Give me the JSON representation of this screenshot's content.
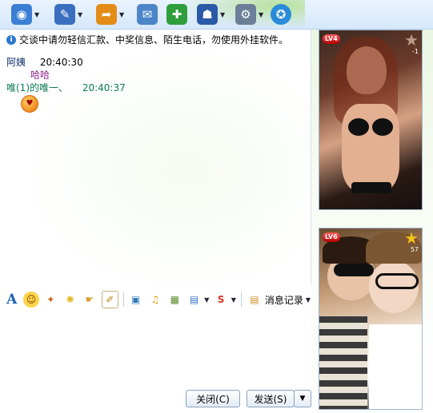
{
  "toolbar": {
    "icons": [
      {
        "name": "video-call-icon",
        "glyph": "◉",
        "color": "#3b7fd4"
      },
      {
        "name": "voice-call-icon",
        "glyph": "✎",
        "color": "#3a6fc0"
      },
      {
        "name": "send-file-icon",
        "glyph": "➦",
        "color": "#e38d18"
      },
      {
        "name": "message-icon",
        "glyph": "✉",
        "color": "#4d86c8"
      },
      {
        "name": "app-add-icon",
        "glyph": "✚",
        "color": "#2f9e3c"
      },
      {
        "name": "security-icon",
        "glyph": "☗",
        "color": "#2a5aa8"
      },
      {
        "name": "settings-icon",
        "glyph": "⚙",
        "color": "#6b7f99"
      },
      {
        "name": "qzone-icon",
        "glyph": "✪",
        "color": "#2a8bd8"
      }
    ]
  },
  "chat": {
    "notice": "交谈中请勿轻信汇款、中奖信息、陌生电话，勿使用外挂软件。",
    "messages": [
      {
        "sender": "阿姨",
        "time": "20:40:30",
        "body": "哈哈"
      },
      {
        "sender": "唯(1)的唯一、",
        "time": "20:40:37",
        "body": ""
      }
    ]
  },
  "format_bar": {
    "icons": [
      {
        "name": "font-icon",
        "glyph": "A",
        "color": "#1c5fb3"
      },
      {
        "name": "emoji-icon",
        "glyph": "☺",
        "color": "#e8a21b"
      },
      {
        "name": "magic-emoji-icon",
        "glyph": "✦",
        "color": "#d2601a"
      },
      {
        "name": "shake-icon",
        "glyph": "✺",
        "color": "#e6b31c"
      },
      {
        "name": "hand-icon",
        "glyph": "☛",
        "color": "#e39c2c"
      },
      {
        "name": "edit-icon",
        "glyph": "✐",
        "color": "#b88518"
      },
      {
        "name": "image-icon",
        "glyph": "▣",
        "color": "#2c7ab8"
      },
      {
        "name": "music-icon",
        "glyph": "♫",
        "color": "#e0a21a"
      },
      {
        "name": "gift-icon",
        "glyph": "▦",
        "color": "#5a8b2a"
      },
      {
        "name": "screenshot-icon",
        "glyph": "▤",
        "color": "#3a76c4"
      },
      {
        "name": "soso-icon",
        "glyph": "S",
        "color": "#d33a2a"
      }
    ],
    "history_label": "消息记录"
  },
  "buttons": {
    "close_label": "关闭(C)",
    "send_label": "发送(S)"
  },
  "profiles": [
    {
      "level": "LV4",
      "star_count": "-1"
    },
    {
      "level": "LV6",
      "star_count": "57"
    }
  ],
  "colors": {
    "toolbar_bg": "#d6e8fb",
    "message_body": "#8b1c8b",
    "level_badge": "#b10000"
  }
}
